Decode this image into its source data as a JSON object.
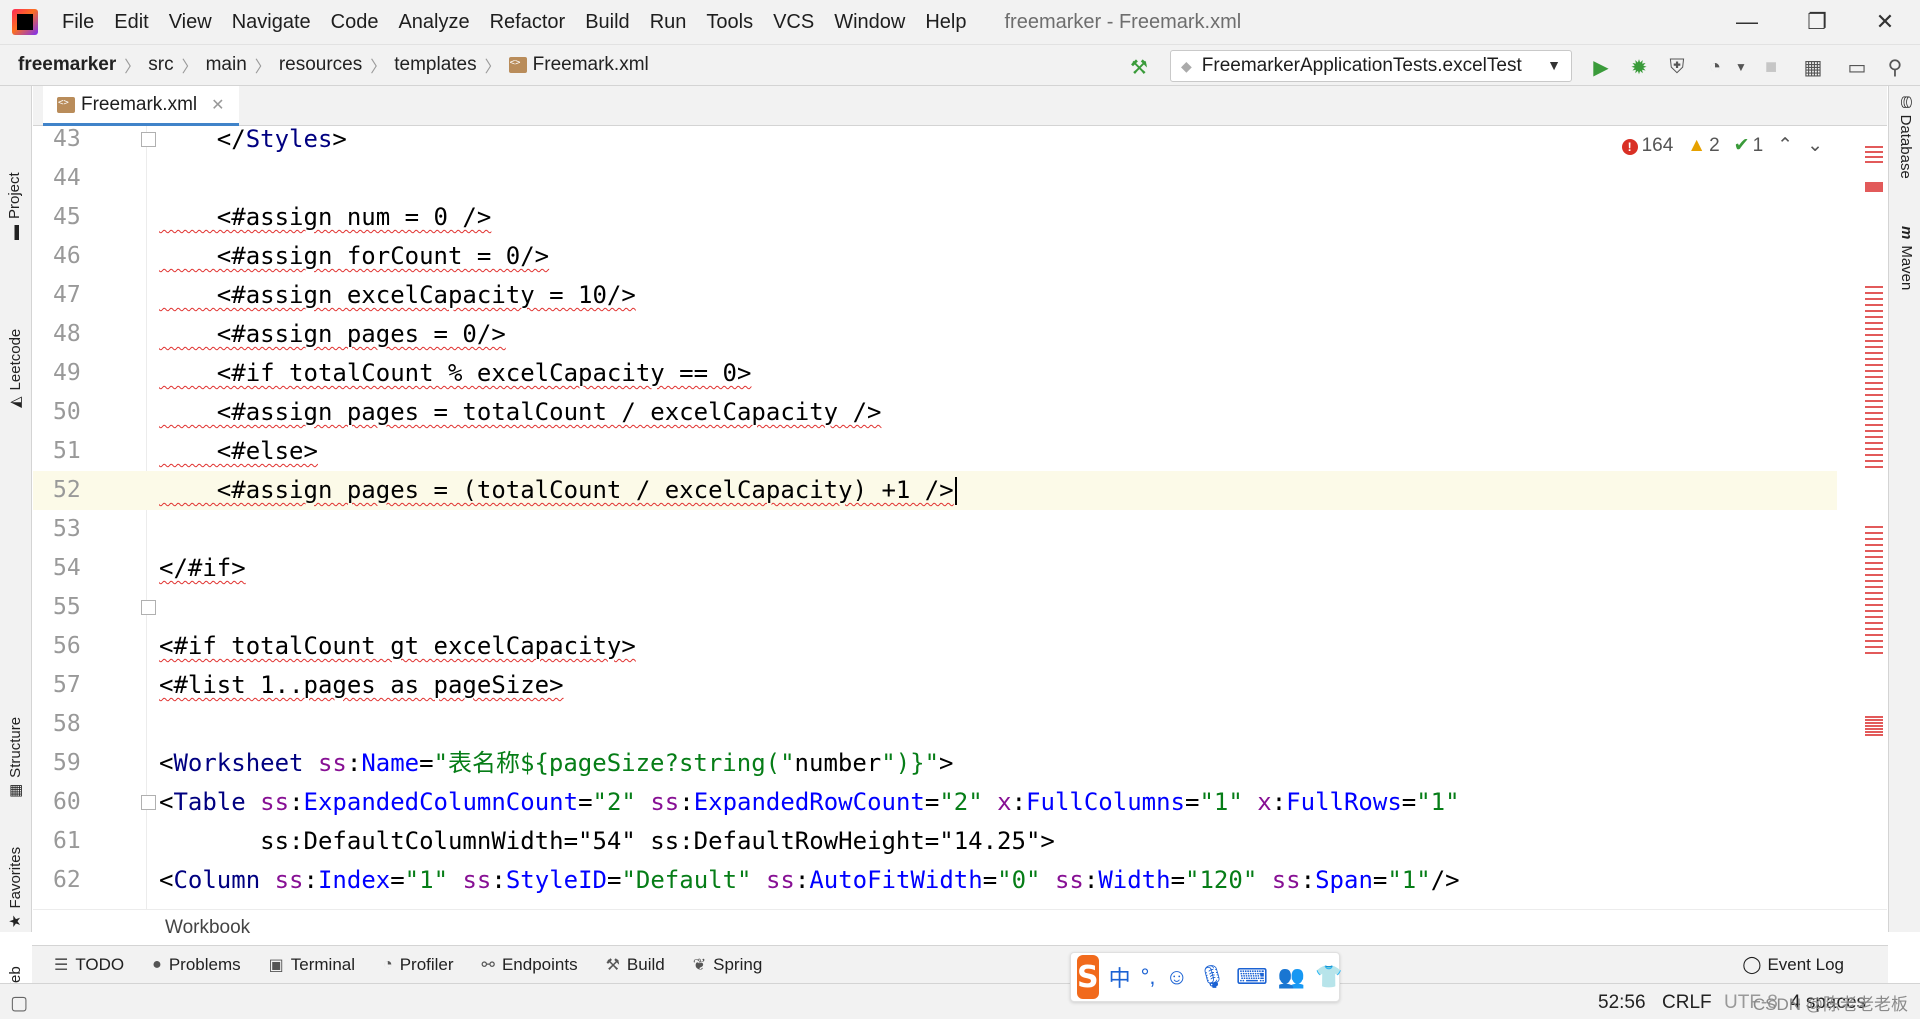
{
  "window": {
    "title": "freemarker - Freemark.xml",
    "menu": [
      "File",
      "Edit",
      "View",
      "Navigate",
      "Code",
      "Analyze",
      "Refactor",
      "Build",
      "Run",
      "Tools",
      "VCS",
      "Window",
      "Help"
    ],
    "controls": {
      "minimize": "—",
      "restore": "❐",
      "close": "✕"
    }
  },
  "breadcrumb": {
    "items": [
      "freemarker",
      "src",
      "main",
      "resources",
      "templates",
      "Freemark.xml"
    ]
  },
  "run": {
    "config": "FreemarkerApplicationTests.excelTest"
  },
  "left_tools": [
    "Project",
    "Leetcode",
    "Structure",
    "Favorites",
    "Web"
  ],
  "right_tools": [
    "Database",
    "Maven"
  ],
  "editor": {
    "tab": "Freemark.xml",
    "inspections": {
      "errors": "164",
      "warnings": "2",
      "ok": "1"
    },
    "lines": [
      {
        "n": "43",
        "code": "    </Styles>"
      },
      {
        "n": "44",
        "code": ""
      },
      {
        "n": "45",
        "code": "    <#assign num = 0 />"
      },
      {
        "n": "46",
        "code": "    <#assign forCount = 0/>"
      },
      {
        "n": "47",
        "code": "    <#assign excelCapacity = 10/>"
      },
      {
        "n": "48",
        "code": "    <#assign pages = 0/>"
      },
      {
        "n": "49",
        "code": "    <#if totalCount % excelCapacity == 0>"
      },
      {
        "n": "50",
        "code": "    <#assign pages = totalCount / excelCapacity />"
      },
      {
        "n": "51",
        "code": "    <#else>"
      },
      {
        "n": "52",
        "code": "    <#assign pages = (totalCount / excelCapacity) +1 />"
      },
      {
        "n": "53",
        "code": ""
      },
      {
        "n": "54",
        "code": "</#if>"
      },
      {
        "n": "55",
        "code": ""
      },
      {
        "n": "56",
        "code": "<#if totalCount gt excelCapacity>"
      },
      {
        "n": "57",
        "code": "<#list 1..pages as pageSize>"
      },
      {
        "n": "58",
        "code": ""
      },
      {
        "n": "59",
        "code": "<Worksheet ss:Name=\"表名称${pageSize?string(\"number\")}\">"
      },
      {
        "n": "60",
        "code": "<Table ss:ExpandedColumnCount=\"2\" ss:ExpandedRowCount=\"2\" x:FullColumns=\"1\" x:FullRows=\"1\""
      },
      {
        "n": "61",
        "code": "       ss:DefaultColumnWidth=\"54\" ss:DefaultRowHeight=\"14.25\">"
      },
      {
        "n": "62",
        "code": "<Column ss:Index=\"1\" ss:StyleID=\"Default\" ss:AutoFitWidth=\"0\" ss:Width=\"120\" ss:Span=\"1\"/>"
      }
    ],
    "current_line": "52",
    "footer_crumb": "Workbook"
  },
  "tool_windows": [
    "TODO",
    "Problems",
    "Terminal",
    "Profiler",
    "Endpoints",
    "Build",
    "Spring"
  ],
  "event_log": "Event Log",
  "status": {
    "position": "52:56",
    "line_sep": "CRLF",
    "encoding": "UTF-8",
    "indent": "4 spaces"
  },
  "ime": {
    "logo": "S",
    "mode": "中"
  },
  "watermark": "CSDN @陈老老老板",
  "colors": {
    "accent": "#4083c9",
    "error": "#d93025",
    "warning": "#e6a100",
    "run": "#3a9b3a"
  }
}
